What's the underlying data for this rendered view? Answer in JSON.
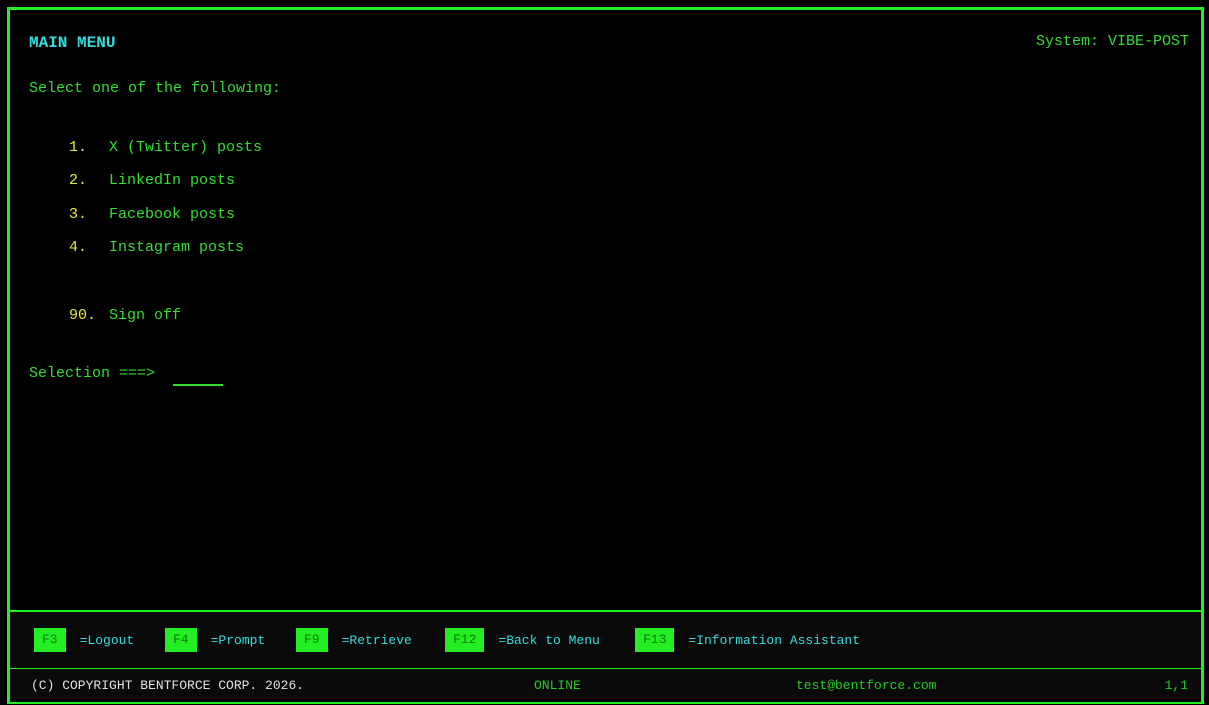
{
  "header": {
    "title": "MAIN MENU",
    "system_label": "System:",
    "system_name": "VIBE-POST"
  },
  "instruction": "Select one of the following:",
  "menu": {
    "items": [
      {
        "num": "1.",
        "label": "X (Twitter) posts"
      },
      {
        "num": "2.",
        "label": "LinkedIn posts"
      },
      {
        "num": "3.",
        "label": "Facebook posts"
      },
      {
        "num": "4.",
        "label": "Instagram posts"
      },
      {
        "num": "90.",
        "label": "Sign off"
      }
    ]
  },
  "selection": {
    "label": "Selection ===>",
    "value": ""
  },
  "function_keys": [
    {
      "key": "F3",
      "desc": "=Logout"
    },
    {
      "key": "F4",
      "desc": "=Prompt"
    },
    {
      "key": "F9",
      "desc": "=Retrieve"
    },
    {
      "key": "F12",
      "desc": "=Back to Menu"
    },
    {
      "key": "F13",
      "desc": "=Information Assistant"
    }
  ],
  "status": {
    "copyright": "(C) COPYRIGHT BENTFORCE CORP. 2026.",
    "connection": "ONLINE",
    "user_email": "test@bentforce.com",
    "cursor_position": "1,1"
  },
  "colors": {
    "border": "#22ee22",
    "text": "#33dd33",
    "title": "#33dddd",
    "menu_number": "#e8e840",
    "background": "#000000"
  }
}
